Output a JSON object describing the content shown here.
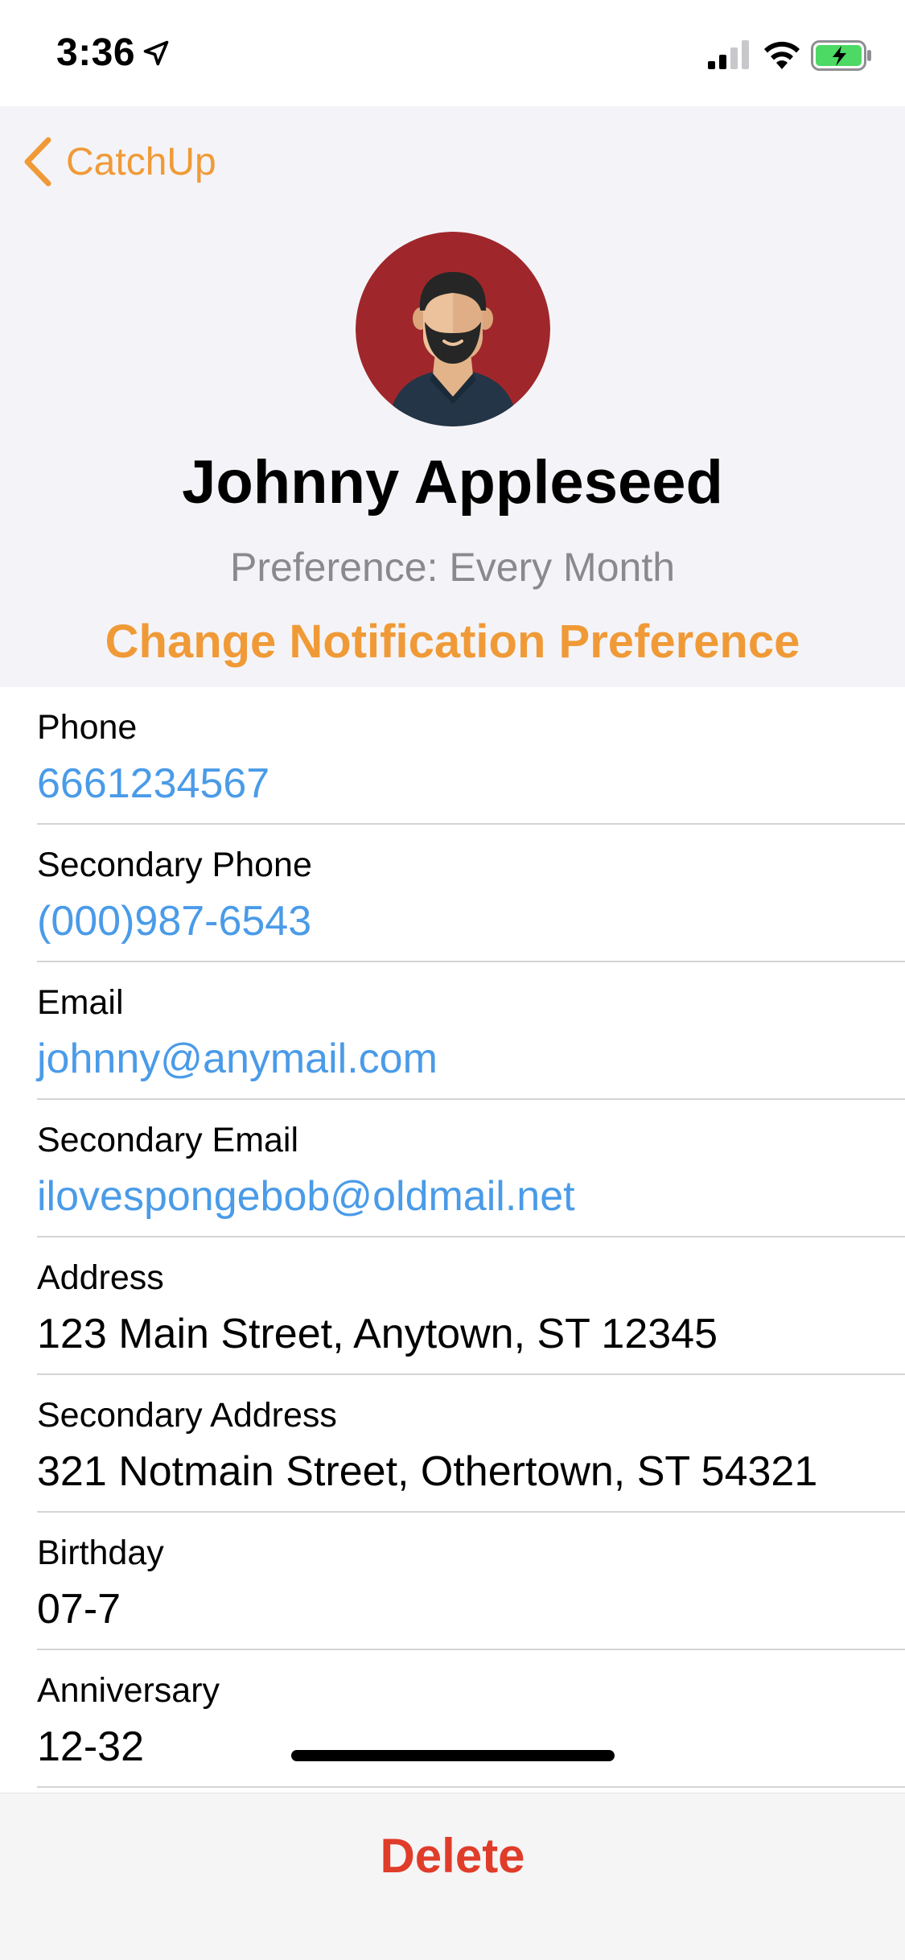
{
  "status_bar": {
    "time": "3:36"
  },
  "nav": {
    "back_label": "CatchUp"
  },
  "contact": {
    "name": "Johnny Appleseed",
    "preference_text": "Preference: Every Month",
    "change_preference_label": "Change Notification Preference"
  },
  "details": [
    {
      "label": "Phone",
      "value": "6661234567"
    },
    {
      "label": "Secondary Phone",
      "value": "(000)987-6543"
    },
    {
      "label": "Email",
      "value": "johnny@anymail.com"
    },
    {
      "label": "Secondary Email",
      "value": "ilovespongebob@oldmail.net"
    },
    {
      "label": "Address",
      "value": "123 Main Street, Anytown, ST 12345"
    },
    {
      "label": "Secondary Address",
      "value": "321 Notmain Street, Othertown, ST 54321"
    },
    {
      "label": "Birthday",
      "value": "07-7"
    },
    {
      "label": "Anniversary",
      "value": "12-32"
    }
  ],
  "toolbar": {
    "delete_label": "Delete"
  },
  "colors": {
    "accent": "#f09a37",
    "link": "#4a9be8",
    "destructive": "#e03c2a",
    "avatar_background": "#9f272b",
    "battery_fill": "#4cd964"
  },
  "icons": {
    "location": "location-arrow-icon",
    "signal": "cellular-signal-icon",
    "wifi": "wifi-icon",
    "battery": "battery-charging-icon",
    "back": "chevron-left-icon"
  }
}
